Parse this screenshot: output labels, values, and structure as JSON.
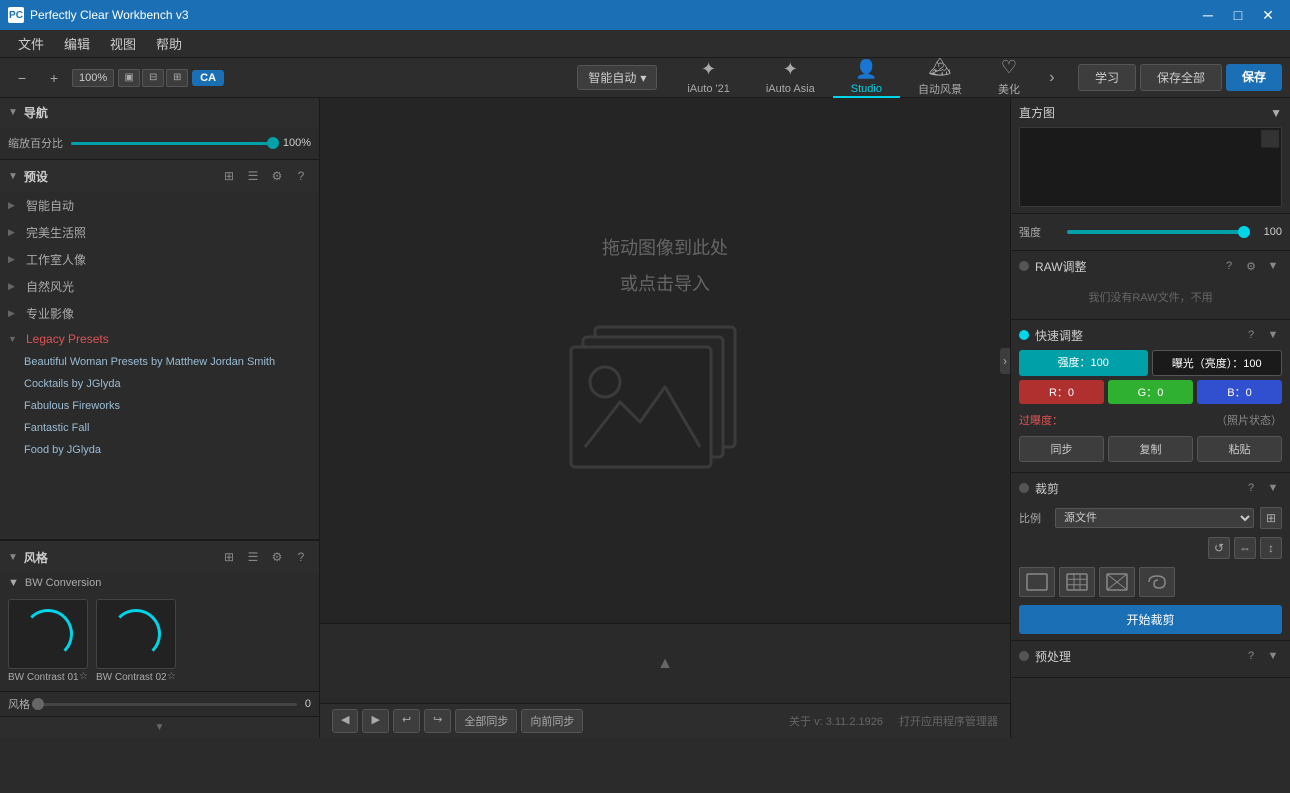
{
  "app": {
    "title": "Perfectly Clear Workbench v3",
    "icon": "PC"
  },
  "titlebar": {
    "title": "Perfectly Clear Workbench v3",
    "minimize": "─",
    "maximize": "□",
    "close": "✕"
  },
  "menubar": {
    "items": [
      "文件",
      "编辑",
      "视图",
      "帮助"
    ]
  },
  "toolbar": {
    "minus": "−",
    "plus": "+",
    "zoom": "100%",
    "ca": "CA",
    "smart_auto": "智能自动",
    "dropdown": "▾"
  },
  "tabs": [
    {
      "label": "iAuto '21",
      "icon": "✦"
    },
    {
      "label": "iAuto Asia",
      "icon": "✦"
    },
    {
      "label": "Studio",
      "icon": "👤"
    },
    {
      "label": "自动风景",
      "icon": "🏔"
    },
    {
      "label": "美化",
      "icon": "♡"
    }
  ],
  "action_buttons": {
    "learn": "学习",
    "save_all": "保存全部",
    "save": "保存"
  },
  "left_panel": {
    "nav_section": {
      "title": "导航",
      "zoom_label": "缩放百分比",
      "zoom_value": "100%"
    },
    "presets_section": {
      "title": "预设",
      "items": [
        {
          "label": "智能自动",
          "type": "category",
          "indent": 1
        },
        {
          "label": "完美生活照",
          "type": "category",
          "indent": 1
        },
        {
          "label": "工作室人像",
          "type": "category",
          "indent": 1
        },
        {
          "label": "自然风光",
          "type": "category",
          "indent": 1
        },
        {
          "label": "专业影像",
          "type": "category",
          "indent": 1
        },
        {
          "label": "Legacy Presets",
          "type": "legacy",
          "indent": 1
        },
        {
          "label": "Beautiful Woman Presets by Matthew Jordan Smith",
          "type": "sub",
          "indent": 2
        },
        {
          "label": "Cocktails by JGlyda",
          "type": "sub",
          "indent": 2
        },
        {
          "label": "Fabulous Fireworks",
          "type": "sub",
          "indent": 2
        },
        {
          "label": "Fantastic Fall",
          "type": "sub",
          "indent": 2
        },
        {
          "label": "Food by JGlyda",
          "type": "sub",
          "indent": 2
        }
      ]
    },
    "styles_section": {
      "title": "风格",
      "sub_title": "BW Conversion",
      "items": [
        {
          "name": "BW Contrast 01"
        },
        {
          "name": "BW Contrast 02"
        }
      ],
      "style_label": "风格",
      "style_value": "0"
    }
  },
  "canvas": {
    "drag_text_line1": "拖动图像到此处",
    "drag_text_line2": "或点击导入"
  },
  "bottom_bar": {
    "nav_left": "◀",
    "nav_right": "▶",
    "undo": "↩",
    "redo": "↪",
    "sync_all": "全部同步",
    "sync_forward": "向前同步",
    "version": "关于 v: 3.11.2.1926",
    "app_manager": "打开应用程序管理器"
  },
  "right_panel": {
    "histogram": {
      "title": "直方图"
    },
    "strength": {
      "label": "强度",
      "value": "100",
      "fill_pct": 100
    },
    "raw_section": {
      "title": "RAW调整",
      "info": "我们没有RAW文件，不用"
    },
    "quick_adjust": {
      "title": "快速调整",
      "strength_label": "强度：100",
      "exposure_label": "曝光（亮度）：100",
      "r_label": "R：0",
      "g_label": "G：0",
      "b_label": "B：0",
      "overexposed": "过曝度：",
      "photo_state": "（照片状态）",
      "sync": "同步",
      "copy": "复制",
      "paste": "粘贴"
    },
    "crop": {
      "title": "裁剪",
      "ratio_label": "比例",
      "ratio_option": "源文件",
      "start_crop": "开始裁剪"
    },
    "preprocess": {
      "title": "预处理"
    }
  }
}
